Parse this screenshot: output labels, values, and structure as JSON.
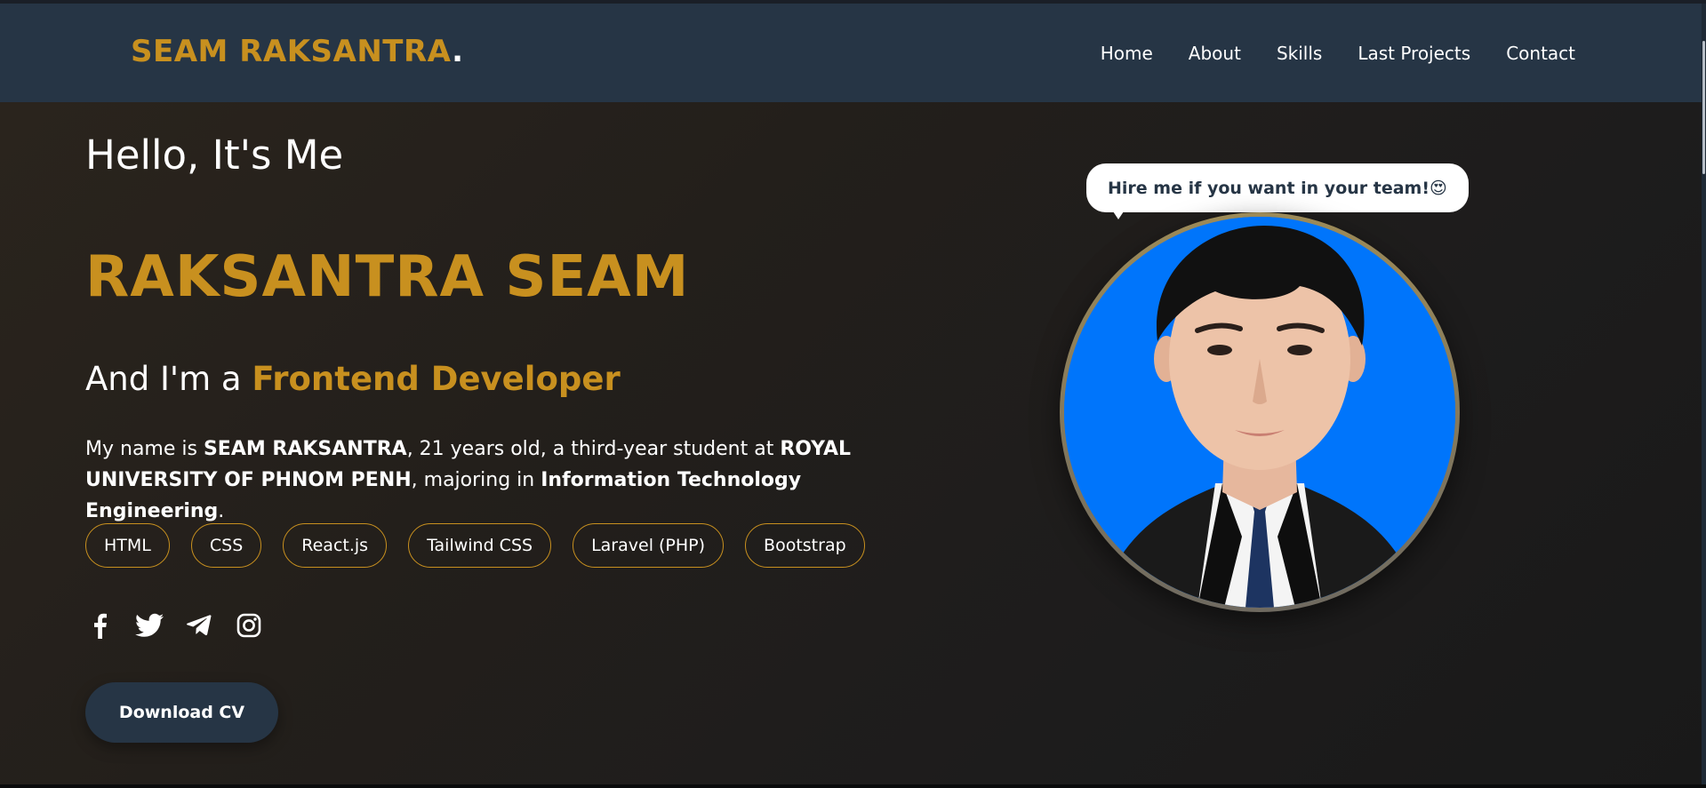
{
  "header": {
    "brand": "SEAM RAKSANTRA",
    "brand_dot": ".",
    "nav": [
      "Home",
      "About",
      "Skills",
      "Last Projects",
      "Contact"
    ]
  },
  "hero": {
    "greeting": "Hello, It's Me",
    "name": "RAKSANTRA SEAM",
    "role_prefix": "And I'm a",
    "role_highlight": "Frontend Developer",
    "bio": {
      "p1": "My name is ",
      "b1": "SEAM RAKSANTRA",
      "p2": ", 21 years old, a third-year student at ",
      "b2": "ROYAL UNIVERSITY OF PHNOM PENH",
      "p3": ", majoring in ",
      "b3": "Information Technology Engineering",
      "p4": "."
    },
    "skills": [
      "HTML",
      "CSS",
      "React.js",
      "Tailwind CSS",
      "Laravel (PHP)",
      "Bootstrap"
    ],
    "socials": [
      "facebook-icon",
      "twitter-icon",
      "telegram-icon",
      "instagram-icon"
    ],
    "cta": "Download CV",
    "bubble": "Hire me if you want in your team!",
    "bubble_emoji": "😍"
  },
  "colors": {
    "accent": "#c8901f",
    "header_bg": "#263545",
    "photo_bg": "#0075fb"
  }
}
